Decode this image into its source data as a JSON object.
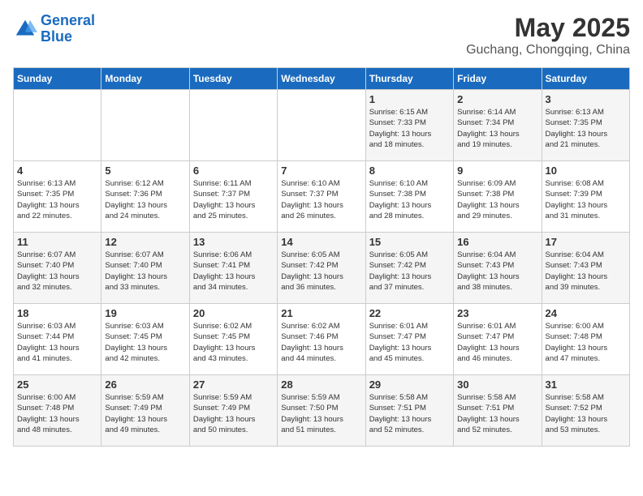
{
  "logo": {
    "line1": "General",
    "line2": "Blue"
  },
  "title": "May 2025",
  "subtitle": "Guchang, Chongqing, China",
  "days_of_week": [
    "Sunday",
    "Monday",
    "Tuesday",
    "Wednesday",
    "Thursday",
    "Friday",
    "Saturday"
  ],
  "weeks": [
    [
      {
        "day": "",
        "content": ""
      },
      {
        "day": "",
        "content": ""
      },
      {
        "day": "",
        "content": ""
      },
      {
        "day": "",
        "content": ""
      },
      {
        "day": "1",
        "content": "Sunrise: 6:15 AM\nSunset: 7:33 PM\nDaylight: 13 hours\nand 18 minutes."
      },
      {
        "day": "2",
        "content": "Sunrise: 6:14 AM\nSunset: 7:34 PM\nDaylight: 13 hours\nand 19 minutes."
      },
      {
        "day": "3",
        "content": "Sunrise: 6:13 AM\nSunset: 7:35 PM\nDaylight: 13 hours\nand 21 minutes."
      }
    ],
    [
      {
        "day": "4",
        "content": "Sunrise: 6:13 AM\nSunset: 7:35 PM\nDaylight: 13 hours\nand 22 minutes."
      },
      {
        "day": "5",
        "content": "Sunrise: 6:12 AM\nSunset: 7:36 PM\nDaylight: 13 hours\nand 24 minutes."
      },
      {
        "day": "6",
        "content": "Sunrise: 6:11 AM\nSunset: 7:37 PM\nDaylight: 13 hours\nand 25 minutes."
      },
      {
        "day": "7",
        "content": "Sunrise: 6:10 AM\nSunset: 7:37 PM\nDaylight: 13 hours\nand 26 minutes."
      },
      {
        "day": "8",
        "content": "Sunrise: 6:10 AM\nSunset: 7:38 PM\nDaylight: 13 hours\nand 28 minutes."
      },
      {
        "day": "9",
        "content": "Sunrise: 6:09 AM\nSunset: 7:38 PM\nDaylight: 13 hours\nand 29 minutes."
      },
      {
        "day": "10",
        "content": "Sunrise: 6:08 AM\nSunset: 7:39 PM\nDaylight: 13 hours\nand 31 minutes."
      }
    ],
    [
      {
        "day": "11",
        "content": "Sunrise: 6:07 AM\nSunset: 7:40 PM\nDaylight: 13 hours\nand 32 minutes."
      },
      {
        "day": "12",
        "content": "Sunrise: 6:07 AM\nSunset: 7:40 PM\nDaylight: 13 hours\nand 33 minutes."
      },
      {
        "day": "13",
        "content": "Sunrise: 6:06 AM\nSunset: 7:41 PM\nDaylight: 13 hours\nand 34 minutes."
      },
      {
        "day": "14",
        "content": "Sunrise: 6:05 AM\nSunset: 7:42 PM\nDaylight: 13 hours\nand 36 minutes."
      },
      {
        "day": "15",
        "content": "Sunrise: 6:05 AM\nSunset: 7:42 PM\nDaylight: 13 hours\nand 37 minutes."
      },
      {
        "day": "16",
        "content": "Sunrise: 6:04 AM\nSunset: 7:43 PM\nDaylight: 13 hours\nand 38 minutes."
      },
      {
        "day": "17",
        "content": "Sunrise: 6:04 AM\nSunset: 7:43 PM\nDaylight: 13 hours\nand 39 minutes."
      }
    ],
    [
      {
        "day": "18",
        "content": "Sunrise: 6:03 AM\nSunset: 7:44 PM\nDaylight: 13 hours\nand 41 minutes."
      },
      {
        "day": "19",
        "content": "Sunrise: 6:03 AM\nSunset: 7:45 PM\nDaylight: 13 hours\nand 42 minutes."
      },
      {
        "day": "20",
        "content": "Sunrise: 6:02 AM\nSunset: 7:45 PM\nDaylight: 13 hours\nand 43 minutes."
      },
      {
        "day": "21",
        "content": "Sunrise: 6:02 AM\nSunset: 7:46 PM\nDaylight: 13 hours\nand 44 minutes."
      },
      {
        "day": "22",
        "content": "Sunrise: 6:01 AM\nSunset: 7:47 PM\nDaylight: 13 hours\nand 45 minutes."
      },
      {
        "day": "23",
        "content": "Sunrise: 6:01 AM\nSunset: 7:47 PM\nDaylight: 13 hours\nand 46 minutes."
      },
      {
        "day": "24",
        "content": "Sunrise: 6:00 AM\nSunset: 7:48 PM\nDaylight: 13 hours\nand 47 minutes."
      }
    ],
    [
      {
        "day": "25",
        "content": "Sunrise: 6:00 AM\nSunset: 7:48 PM\nDaylight: 13 hours\nand 48 minutes."
      },
      {
        "day": "26",
        "content": "Sunrise: 5:59 AM\nSunset: 7:49 PM\nDaylight: 13 hours\nand 49 minutes."
      },
      {
        "day": "27",
        "content": "Sunrise: 5:59 AM\nSunset: 7:49 PM\nDaylight: 13 hours\nand 50 minutes."
      },
      {
        "day": "28",
        "content": "Sunrise: 5:59 AM\nSunset: 7:50 PM\nDaylight: 13 hours\nand 51 minutes."
      },
      {
        "day": "29",
        "content": "Sunrise: 5:58 AM\nSunset: 7:51 PM\nDaylight: 13 hours\nand 52 minutes."
      },
      {
        "day": "30",
        "content": "Sunrise: 5:58 AM\nSunset: 7:51 PM\nDaylight: 13 hours\nand 52 minutes."
      },
      {
        "day": "31",
        "content": "Sunrise: 5:58 AM\nSunset: 7:52 PM\nDaylight: 13 hours\nand 53 minutes."
      }
    ]
  ]
}
